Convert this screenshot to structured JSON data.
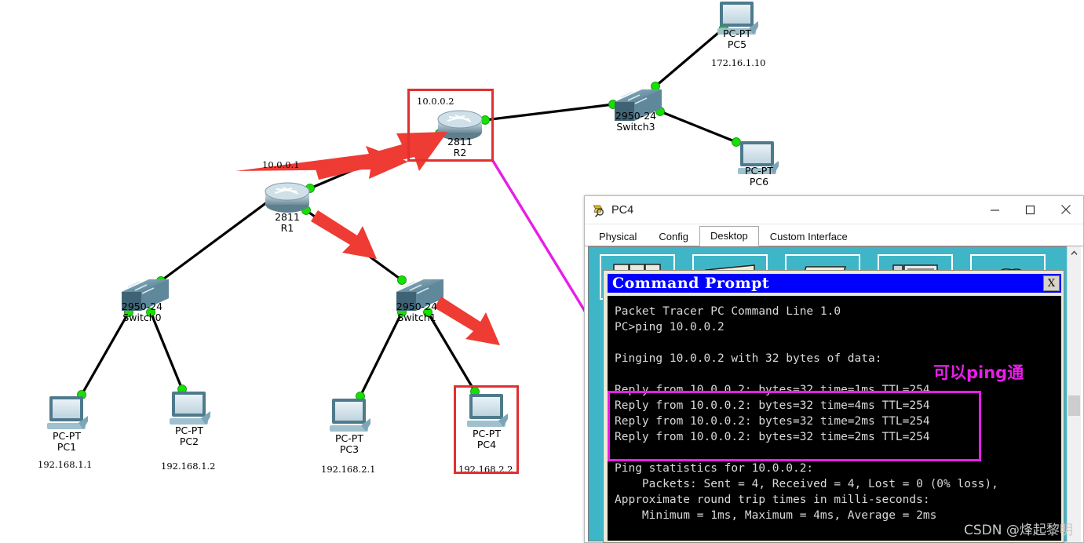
{
  "topology": {
    "nodes": [
      {
        "id": "r1",
        "type": "router",
        "model": "2811",
        "name": "R1",
        "ip": "10.0.0.1"
      },
      {
        "id": "r2",
        "type": "router",
        "model": "2811",
        "name": "R2",
        "ip": "10.0.0.2"
      },
      {
        "id": "switch0",
        "type": "switch",
        "model": "2950-24",
        "name": "Switch0",
        "ip": ""
      },
      {
        "id": "switch1",
        "type": "switch",
        "model": "2950-24",
        "name": "Switch1",
        "ip": ""
      },
      {
        "id": "switch3",
        "type": "switch",
        "model": "2950-24",
        "name": "Switch3",
        "ip": ""
      },
      {
        "id": "pc1",
        "type": "pc",
        "model": "PC-PT",
        "name": "PC1",
        "ip": "192.168.1.1"
      },
      {
        "id": "pc2",
        "type": "pc",
        "model": "PC-PT",
        "name": "PC2",
        "ip": "192.168.1.2"
      },
      {
        "id": "pc3",
        "type": "pc",
        "model": "PC-PT",
        "name": "PC3",
        "ip": "192.168.2.1"
      },
      {
        "id": "pc4",
        "type": "pc",
        "model": "PC-PT",
        "name": "PC4",
        "ip": "192.168.2.2"
      },
      {
        "id": "pc5",
        "type": "pc",
        "model": "PC-PT",
        "name": "PC5",
        "ip": "172.16.1.10"
      },
      {
        "id": "pc6",
        "type": "pc",
        "model": "PC-PT",
        "name": "PC6",
        "ip": ""
      }
    ],
    "annotations": {
      "highlight_color": "#e03030",
      "arrow_color": "#ee3b33",
      "pointer_color": "#e81de8"
    }
  },
  "window": {
    "title": "PC4",
    "icon": "packet-tracer-icon",
    "controls": {
      "minimize": "—",
      "maximize": "□",
      "close": "✕"
    },
    "tabs": [
      {
        "label": "Physical",
        "active": false
      },
      {
        "label": "Config",
        "active": false
      },
      {
        "label": "Desktop",
        "active": true
      },
      {
        "label": "Custom Interface",
        "active": false
      }
    ]
  },
  "command_prompt": {
    "title": "Command Prompt",
    "close_label": "X",
    "lines": [
      "Packet Tracer PC Command Line 1.0",
      "PC>ping 10.0.0.2",
      "",
      "Pinging 10.0.0.2 with 32 bytes of data:",
      "",
      "Reply from 10.0.0.2: bytes=32 time=1ms TTL=254",
      "Reply from 10.0.0.2: bytes=32 time=4ms TTL=254",
      "Reply from 10.0.0.2: bytes=32 time=2ms TTL=254",
      "Reply from 10.0.0.2: bytes=32 time=2ms TTL=254",
      "",
      "Ping statistics for 10.0.0.2:",
      "    Packets: Sent = 4, Received = 4, Lost = 0 (0% loss),",
      "Approximate round trip times in milli-seconds:",
      "    Minimum = 1ms, Maximum = 4ms, Average = 2ms"
    ]
  },
  "annotation": {
    "chinese_note": "可以ping通",
    "watermark": "CSDN @烽起黎明"
  }
}
